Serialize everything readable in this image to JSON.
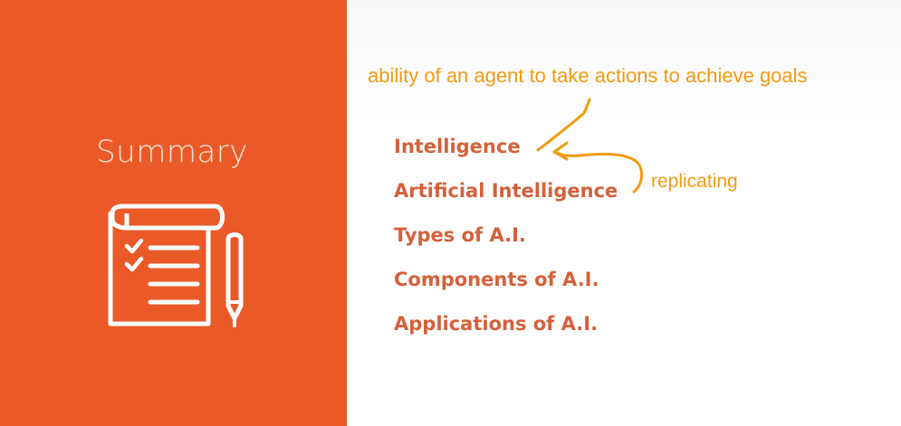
{
  "slide": {
    "title": "Summary",
    "icon": "checklist-notepad-with-pen-icon",
    "topics": [
      "Intelligence",
      "Artificial Intelligence",
      "Types of A.I.",
      "Components of A.I.",
      "Applications of A.I."
    ]
  },
  "annotations": {
    "definition": "ability of an agent to take actions to achieve goals",
    "replicating": "replicating"
  },
  "colors": {
    "accent_orange": "#ea5a28",
    "topic_text": "#d5603a",
    "ink": "#f29a12"
  }
}
